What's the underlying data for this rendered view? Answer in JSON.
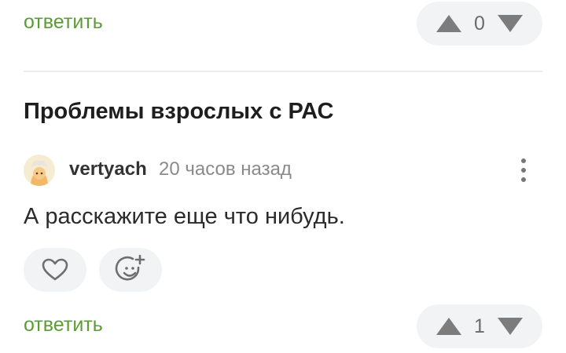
{
  "top_comment": {
    "reply_label": "ответить",
    "vote_count": "0"
  },
  "post": {
    "title": "Проблемы взрослых с РАС"
  },
  "comment": {
    "author": "vertyach",
    "timestamp": "20 часов назад",
    "text": "А расскажите еще что нибудь.",
    "reply_label": "ответить",
    "vote_count": "1"
  },
  "icons": {
    "upvote": "triangle-up-icon",
    "downvote": "triangle-down-icon",
    "like": "heart-icon",
    "add_reaction": "smiley-plus-icon",
    "more": "vertical-dots-icon"
  },
  "colors": {
    "reply_link": "#5b9c35",
    "pill_bg": "#f2f3f5",
    "icon_gray": "#7c7c7c"
  }
}
